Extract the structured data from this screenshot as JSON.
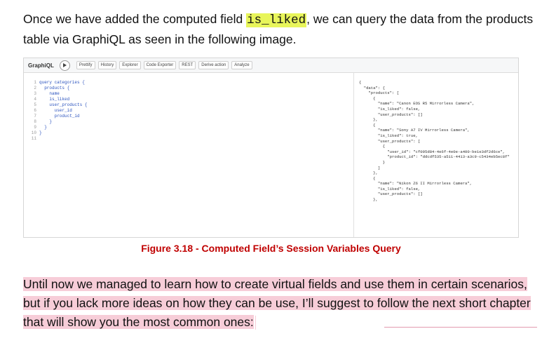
{
  "intro": {
    "before": "Once we have added the computed field ",
    "code": "is_liked",
    "after": ", we can query the data from the products table via GraphiQL as seen in the following image."
  },
  "graphiql": {
    "brand": "GraphiQL",
    "buttons": [
      "Prettify",
      "History",
      "Explorer",
      "Code Exporter",
      "REST",
      "Derive action",
      "Analyze"
    ],
    "line_numbers": [
      "1",
      "2",
      "3",
      "4",
      "5",
      "6",
      "7",
      "8",
      "9",
      "10",
      "11"
    ],
    "query_lines": [
      "query categories {",
      "  products {",
      "    name",
      "    is_liked",
      "    user_products {",
      "      user_id",
      "      product_id",
      "    }",
      "  }",
      "}",
      ""
    ],
    "result_lines": [
      "{",
      "  \"data\": {",
      "    \"products\": [",
      "      {",
      "        \"name\": \"Canon EOS R5 Mirrorless Camera\",",
      "        \"is_liked\": false,",
      "        \"user_products\": []",
      "      },",
      "      {",
      "        \"name\": \"Sony A7 IV Mirrorless Camera\",",
      "        \"is_liked\": true,",
      "        \"user_products\": [",
      "          {",
      "            \"user_id\": \"cf095d84-4e6f-4e0e-a400-be1e3df2d6ce\",",
      "            \"product_id\": \"ddcdf535-a511-4413-a3c9-c5434eb5ec8f\"",
      "          }",
      "        ]",
      "      },",
      "      {",
      "        \"name\": \"Nikon Z6 II Mirrorless Camera\",",
      "        \"is_liked\": false,",
      "        \"user_products\": []",
      "      },"
    ]
  },
  "caption": "Figure 3.18 - Computed Field’s Session Variables Query",
  "paragraph": "Until now we managed to learn how to create virtual fields and use them in certain scenarios, but if you lack more ideas on how they can be use, I’ll suggest to follow the next short chapter that will show you the most common ones:"
}
